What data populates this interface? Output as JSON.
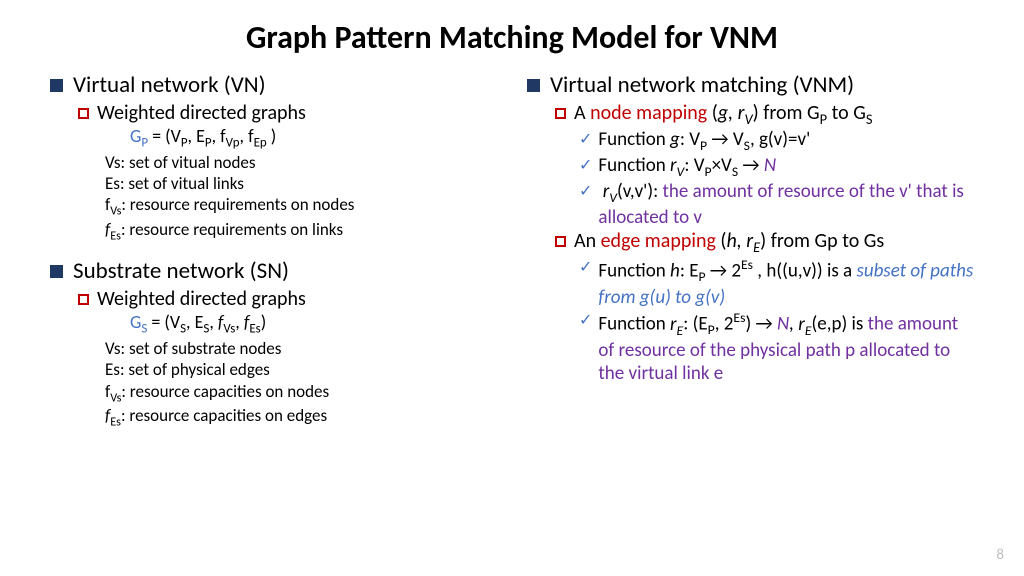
{
  "title": "Graph Pattern Matching Model for VNM",
  "page_number": "8",
  "left": {
    "vn_heading": "Virtual network (VN)",
    "vn_sub": "Weighted directed graphs",
    "vn_formula_lhs": "G",
    "vn_formula_rhs": " = (V",
    "vn_defs": {
      "vs": "Vs: set of vitual nodes",
      "es": "Es: set of vitual links",
      "fvs_label": "f",
      "fvs_text": ":  resource requirements on nodes",
      "fes_label": "f",
      "fes_text": ":  resource  requirements on links"
    },
    "sn_heading": "Substrate network (SN)",
    "sn_sub": "Weighted directed graphs",
    "sn_defs": {
      "vs": "Vs: set of substrate nodes",
      "es": "Es: set of physical edges",
      "fvs_label": "f",
      "fvs_text": ":  resource capacities on nodes",
      "fes_label": "f",
      "fes_text": ":  resource capacities on edges"
    }
  },
  "right": {
    "vnm_heading": "Virtual network matching (VNM)",
    "node_mapping_a": "A ",
    "node_mapping_red": "node mapping",
    "node_mapping_open": " (",
    "node_mapping_close": ") from G",
    "node_mapping_to": "  to G",
    "fn_g_pre": "Function ",
    "fn_g_mid": ": V",
    "fn_g_arrow": " → V",
    "fn_g_tail": ", g(v)=v'",
    "fn_rv_pre": "Function ",
    "fn_rv_mid": ": V",
    "fn_rv_times": "×V",
    "fn_rv_arrow": " → ",
    "fn_rv_N": "N",
    "rv_desc_pre": "(v,v'): ",
    "rv_desc": "the amount of resource of the  v' that is allocated to v",
    "edge_mapping_an": "An ",
    "edge_mapping_red": "edge mapping",
    "edge_mapping_open": " (",
    "edge_mapping_close": ") from Gp to Gs",
    "fn_h_pre": "Function ",
    "fn_h_mid": ": E",
    "fn_h_arrow": " → 2",
    "fn_h_tail1": " , h((u,v)) is a ",
    "fn_h_tail2": "subset of paths from g(u) to g(v)",
    "fn_re_pre": "Function ",
    "fn_re_open": ": (E",
    "fn_re_mid": ", 2",
    "fn_re_close": ") → ",
    "fn_re_N": "N",
    "fn_re_comma": ", ",
    "fn_re_tail": "(e,p) is ",
    "fn_re_desc": "the amount of resource of the physical path p allocated to the virtual link e"
  }
}
